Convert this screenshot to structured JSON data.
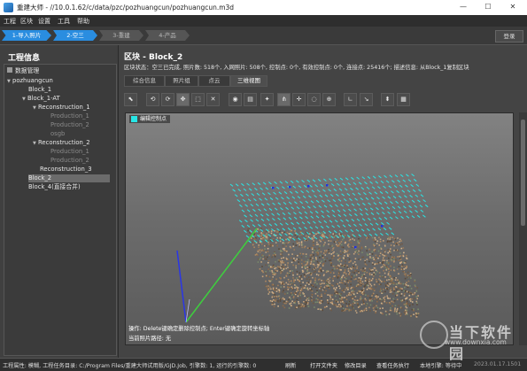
{
  "titlebar": {
    "title": "重建大师 - //10.0.1.62/c/data/pzc/pozhuangcun/pozhuangcun.m3d",
    "minimize_glyph": "—",
    "maximize_glyph": "☐",
    "close_glyph": "✕"
  },
  "menu": [
    "工程",
    "区块",
    "设置",
    "工具",
    "帮助"
  ],
  "steps": {
    "s1": "1-导入照片",
    "s2": "2-空三",
    "s3": "3-重建",
    "s4": "4-产品",
    "logout": "登录"
  },
  "left": {
    "header": "工程信息",
    "tree": {
      "data_mgmt": "数据管理",
      "project": "pozhuangcun",
      "block1": "Block_1",
      "block1at": "Block_1-AT",
      "recon1": "Reconstruction_1",
      "prod1": "Production_1",
      "prod2": "Production_2",
      "osgb": "osgb",
      "recon2": "Reconstruction_2",
      "r2prod1": "Production_1",
      "r2prod2": "Production_2",
      "recon3": "Reconstruction_3",
      "block2": "Block_2",
      "block4": "Block_4(直接合并)"
    }
  },
  "block": {
    "title": "区块 - Block_2",
    "status": "区块状态：空三已完成, 照片数: 518个, 入网照片: 508个, 控制点: 0个, 有效控制点: 0个, 连接点: 25416个; 描述信息: 从Block_1复制区块",
    "tabs": [
      "综合信息",
      "照片组",
      "点云",
      "三维视图"
    ],
    "toolbar_icons": [
      "cursor-icon",
      "rotate-left-icon",
      "rotate-right-icon",
      "pan-icon",
      "zoom-box-icon",
      "delete-icon",
      "camera-icon",
      "film-icon",
      "gear-icon",
      "share-icon",
      "add-point-icon",
      "remove-point-icon",
      "move-point-icon",
      "axis-l-icon",
      "axis-icon",
      "pin-icon",
      "image-icon"
    ],
    "toolbar_glyphs": [
      "⬉",
      "⟲",
      "⟳",
      "✥",
      "⬚",
      "✕",
      "◉",
      "▤",
      "✦",
      "⋔",
      "✛",
      "◌",
      "⊕",
      "∟",
      "↘",
      "⬍",
      "▦"
    ],
    "legend": "编辑控制点",
    "ops_hint": "操作: Delete键确定删除控制点; Enter键确定旋转坐标轴",
    "current_path": "当前照片路径: 无"
  },
  "status": {
    "left": "工程属性: 模糊, 工程任务目录: C:/Program Files/重建大师试用版/GJD.Job, 引擎数: 1, 运行的引擎数: 0",
    "refresh": "刷新",
    "open_folder": "打开文件夹",
    "modify_dir": "修改目录",
    "view_tasks": "查看任务执行",
    "local_engine": "本地引擎: 等待中",
    "version": "2023.01.17.1501"
  },
  "watermark": {
    "name": "当下软件园",
    "url": "www.downxia.com"
  },
  "colors": {
    "accent": "#2a8de0",
    "control_point": "#28e6e6"
  }
}
